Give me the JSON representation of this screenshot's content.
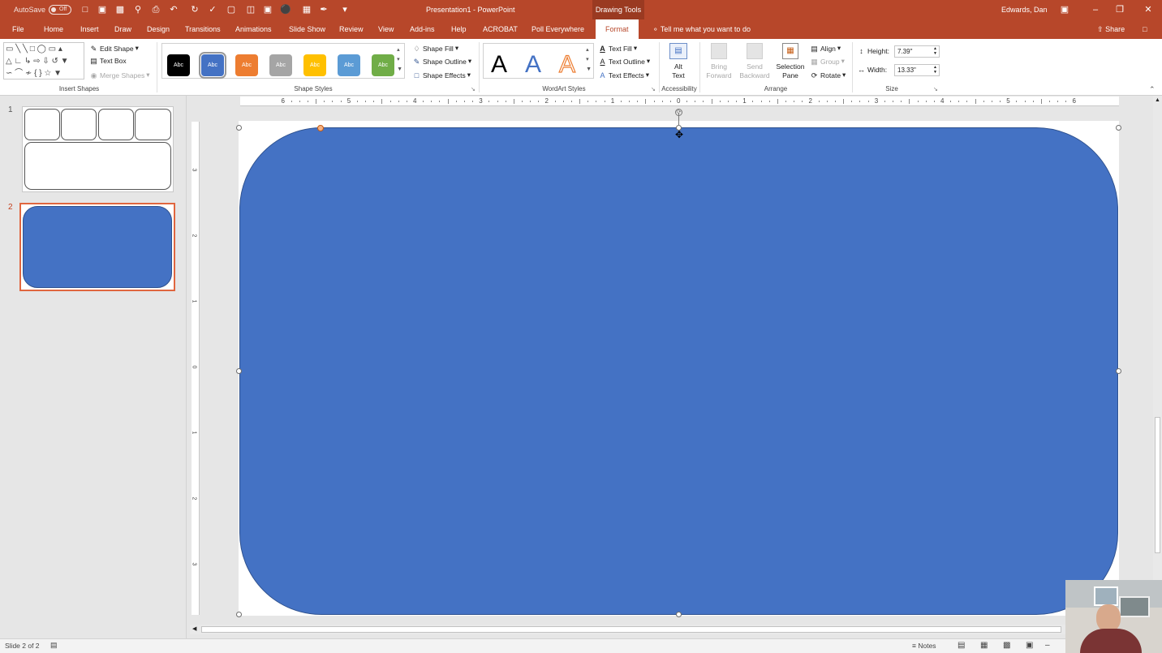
{
  "titlebar": {
    "autosave_label": "AutoSave",
    "autosave_state": "Off",
    "doc_title": "Presentation1 - PowerPoint",
    "drawing_tools": "Drawing Tools",
    "user": "Edwards, Dan"
  },
  "tabs": [
    {
      "label": "File"
    },
    {
      "label": "Home"
    },
    {
      "label": "Insert"
    },
    {
      "label": "Draw"
    },
    {
      "label": "Design"
    },
    {
      "label": "Transitions"
    },
    {
      "label": "Animations"
    },
    {
      "label": "Slide Show"
    },
    {
      "label": "Review"
    },
    {
      "label": "View"
    },
    {
      "label": "Add-ins"
    },
    {
      "label": "Help"
    },
    {
      "label": "ACROBAT"
    },
    {
      "label": "Poll Everywhere"
    },
    {
      "label": "Format"
    }
  ],
  "tell_me": "Tell me what you want to do",
  "share": "Share",
  "ribbon": {
    "insert_shapes": {
      "label": "Insert Shapes",
      "edit_shape": "Edit Shape",
      "text_box": "Text Box",
      "merge_shapes": "Merge Shapes"
    },
    "shape_styles": {
      "label": "Shape Styles",
      "styles": [
        {
          "text": "Abc",
          "color": "#000000"
        },
        {
          "text": "Abc",
          "color": "#4472c4"
        },
        {
          "text": "Abc",
          "color": "#ed7d31"
        },
        {
          "text": "Abc",
          "color": "#a5a5a5"
        },
        {
          "text": "Abc",
          "color": "#ffc000"
        },
        {
          "text": "Abc",
          "color": "#5b9bd5"
        },
        {
          "text": "Abc",
          "color": "#70ad47"
        }
      ],
      "shape_fill": "Shape Fill",
      "shape_outline": "Shape Outline",
      "shape_effects": "Shape Effects"
    },
    "wordart": {
      "label": "WordArt Styles",
      "sample": "A",
      "text_fill": "Text Fill",
      "text_outline": "Text Outline",
      "text_effects": "Text Effects"
    },
    "accessibility": {
      "label": "Accessibility",
      "alt_text_1": "Alt",
      "alt_text_2": "Text"
    },
    "arrange": {
      "label": "Arrange",
      "bring_forward_1": "Bring",
      "bring_forward_2": "Forward",
      "send_backward_1": "Send",
      "send_backward_2": "Backward",
      "selection_pane_1": "Selection",
      "selection_pane_2": "Pane",
      "align": "Align",
      "group": "Group",
      "rotate": "Rotate"
    },
    "size": {
      "label": "Size",
      "height_label": "Height:",
      "height_value": "7.39\"",
      "width_label": "Width:",
      "width_value": "13.33\""
    }
  },
  "slides": [
    {
      "number": "1"
    },
    {
      "number": "2"
    }
  ],
  "ruler": {
    "h_labels": [
      "6",
      "5",
      "4",
      "3",
      "2",
      "1",
      "0",
      "1",
      "2",
      "3",
      "4",
      "5",
      "6"
    ],
    "v_labels": [
      "3",
      "2",
      "1",
      "0",
      "1",
      "2",
      "3"
    ]
  },
  "canvas": {
    "shape_color": "#4472c4",
    "accent": "#b7472a"
  },
  "status": {
    "slide_info": "Slide 2 of 2",
    "notes": "Notes"
  }
}
